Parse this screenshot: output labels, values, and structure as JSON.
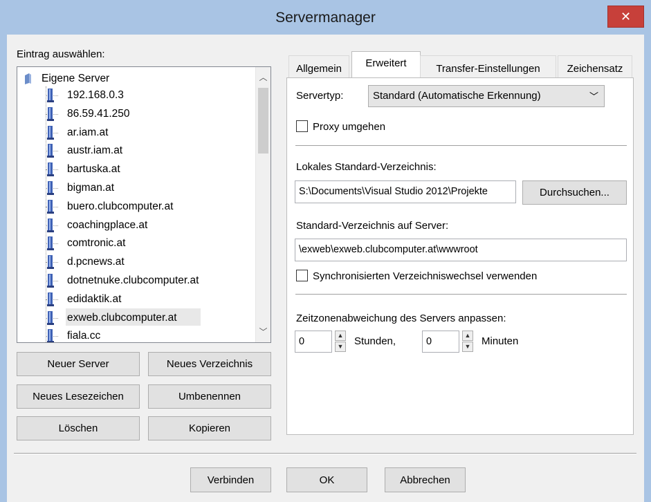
{
  "window": {
    "title": "Servermanager",
    "close_glyph": "✕"
  },
  "tree": {
    "label": "Eintrag auswählen:",
    "root": "Eigene Server",
    "items": [
      "192.168.0.3",
      "86.59.41.250",
      "ar.iam.at",
      "austr.iam.at",
      "bartuska.at",
      "bigman.at",
      "buero.clubcomputer.at",
      "coachingplace.at",
      "comtronic.at",
      "d.pcnews.at",
      "dotnetnuke.clubcomputer.at",
      "edidaktik.at",
      "exweb.clubcomputer.at",
      "fiala.cc"
    ],
    "selected": "exweb.clubcomputer.at"
  },
  "left_buttons": {
    "new_server": "Neuer Server",
    "new_folder": "Neues Verzeichnis",
    "new_bookmark": "Neues Lesezeichen",
    "rename": "Umbenennen",
    "delete": "Löschen",
    "copy": "Kopieren"
  },
  "tabs": [
    {
      "label": "Allgemein",
      "active": false
    },
    {
      "label": "Erweitert",
      "active": true
    },
    {
      "label": "Transfer-Einstellungen",
      "active": false
    },
    {
      "label": "Zeichensatz",
      "active": false
    }
  ],
  "advanced": {
    "servertype_label": "Servertyp:",
    "servertype_value": "Standard (Automatische Erkennung)",
    "bypass_proxy_label": "Proxy umgehen",
    "bypass_proxy_checked": false,
    "local_dir_label": "Lokales Standard-Verzeichnis:",
    "local_dir_value": "S:\\Documents\\Visual Studio 2012\\Projekte",
    "browse_label": "Durchsuchen...",
    "remote_dir_label": "Standard-Verzeichnis auf Server:",
    "remote_dir_value": "\\exweb\\exweb.clubcomputer.at\\wwwroot",
    "sync_browse_label": "Synchronisierten Verzeichniswechsel verwenden",
    "sync_browse_checked": false,
    "timezone_label": "Zeitzonenabweichung des Servers anpassen:",
    "hours_value": "0",
    "hours_label": "Stunden,",
    "minutes_value": "0",
    "minutes_label": "Minuten"
  },
  "footer": {
    "connect": "Verbinden",
    "ok": "OK",
    "cancel": "Abbrechen"
  }
}
